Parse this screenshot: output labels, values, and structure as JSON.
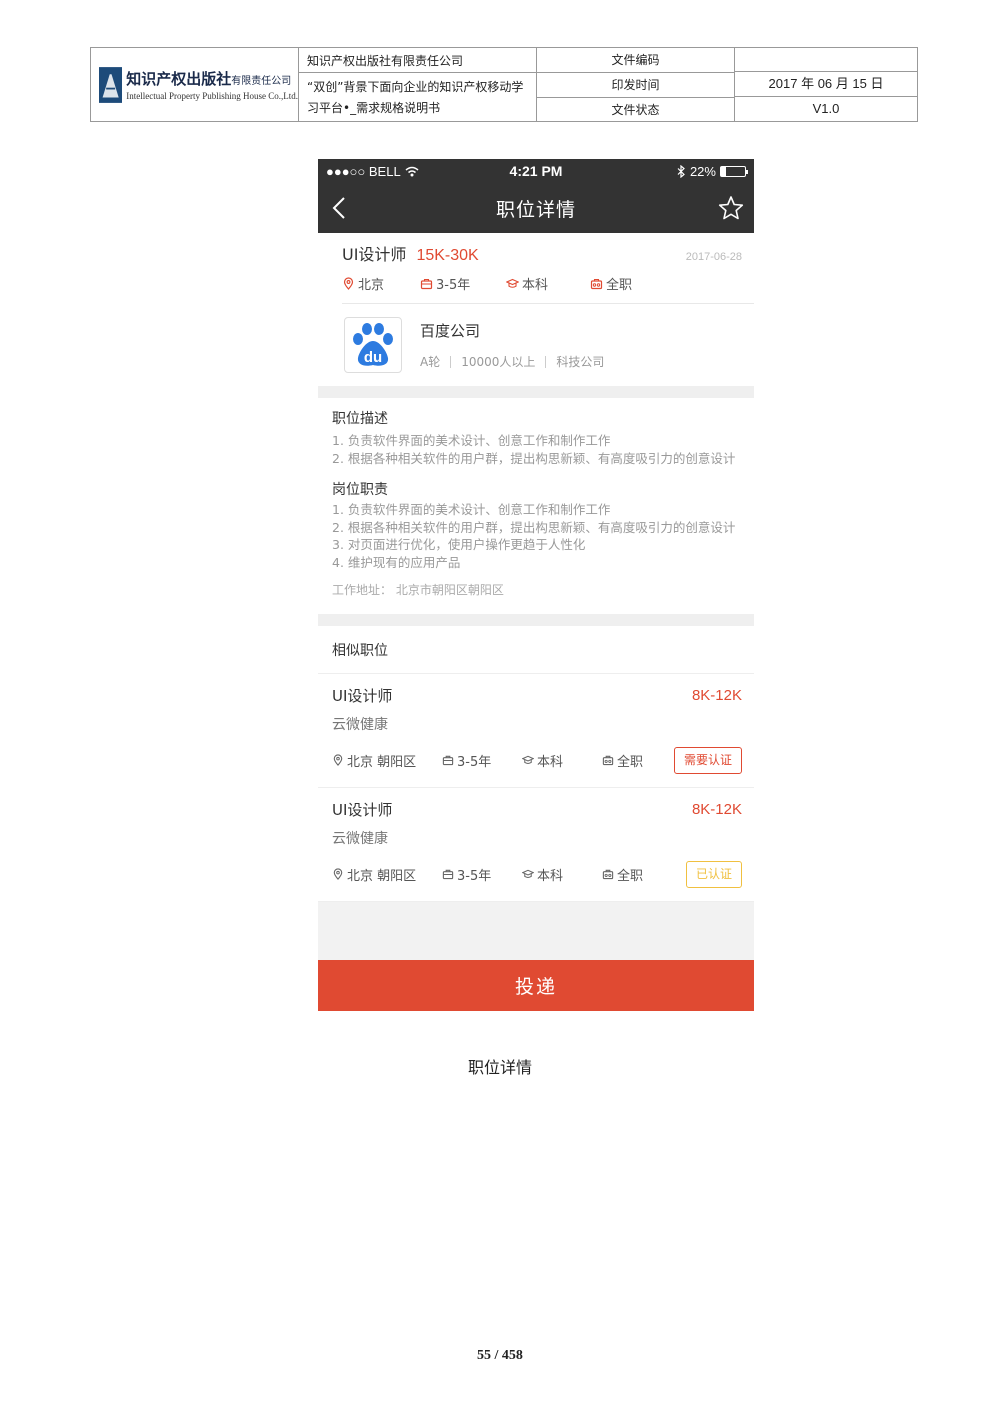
{
  "doc_header": {
    "logo_cn": "知识产权出版社",
    "logo_cn_suffix": "有限责任公司",
    "logo_en": "Intellectual Property Publishing House Co.,Ltd.",
    "company": "知识产权出版社有限责任公司",
    "doc_title": "“双创”背景下面向企业的知识产权移动学习平台•_需求规格说明书",
    "labels": [
      "文件编码",
      "印发时间",
      "文件状态"
    ],
    "values": [
      "",
      "2017 年 06 月 15 日",
      "V1.0"
    ]
  },
  "status_bar": {
    "carrier": "●●●○○ BELL",
    "time": "4:21 PM",
    "battery": "22%",
    "battery_level": 0.22
  },
  "nav": {
    "title": "职位详情"
  },
  "job": {
    "title": "UI设计师",
    "salary": "15K-30K",
    "date": "2017-06-28",
    "tags": {
      "city": "北京",
      "experience": "3-5年",
      "education": "本科",
      "type": "全职"
    }
  },
  "company": {
    "name": "百度公司",
    "stage": "A轮",
    "size": "10000人以上",
    "industry": "科技公司"
  },
  "description": {
    "title": "职位描述",
    "lines": [
      "1. 负责软件界面的美术设计、创意工作和制作工作",
      "2. 根据各种相关软件的用户群，提出构思新颖、有高度吸引力的创意设计"
    ]
  },
  "duties": {
    "title": "岗位职责",
    "lines": [
      "1. 负责软件界面的美术设计、创意工作和制作工作",
      "2. 根据各种相关软件的用户群，提出构思新颖、有高度吸引力的创意设计",
      "3. 对页面进行优化，使用户操作更趋于人性化",
      "4. 维护现有的应用产品"
    ]
  },
  "address": "工作地址：  北京市朝阳区朝阳区",
  "similar": {
    "title": "相似职位",
    "items": [
      {
        "title": "UI设计师",
        "salary": "8K-12K",
        "company": "云微健康",
        "location": "北京 朝阳区",
        "experience": "3-5年",
        "education": "本科",
        "type": "全职",
        "badge": "需要认证",
        "badge_color": "#e04a32"
      },
      {
        "title": "UI设计师",
        "salary": "8K-12K",
        "company": "云微健康",
        "location": "北京 朝阳区",
        "experience": "3-5年",
        "education": "本科",
        "type": "全职",
        "badge": "已认证",
        "badge_color": "#f0c040"
      }
    ]
  },
  "submit_label": "投递",
  "caption": "职位详情",
  "page_number": "55 / 458",
  "colors": {
    "accent": "#e04a32",
    "bar": "#333333",
    "verified": "#f0c040"
  }
}
